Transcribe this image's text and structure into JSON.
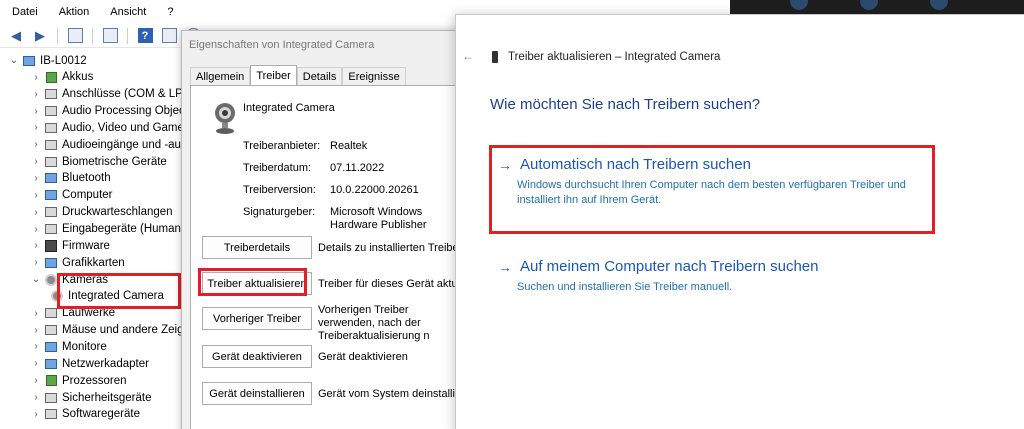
{
  "menu": [
    "Datei",
    "Aktion",
    "Ansicht",
    "?"
  ],
  "tree": {
    "root": "IB-L0012",
    "items": [
      {
        "label": "Akkus",
        "icon": "battery-icon"
      },
      {
        "label": "Anschlüsse (COM & LPT)",
        "icon": "port-icon"
      },
      {
        "label": "Audio Processing Object",
        "icon": "audio-icon"
      },
      {
        "label": "Audio, Video und Gamec",
        "icon": "audio-icon"
      },
      {
        "label": "Audioeingänge und -au",
        "icon": "audio-icon"
      },
      {
        "label": "Biometrische Geräte",
        "icon": "fingerprint-icon"
      },
      {
        "label": "Bluetooth",
        "icon": "bluetooth-icon"
      },
      {
        "label": "Computer",
        "icon": "monitor-icon"
      },
      {
        "label": "Druckwarteschlangen",
        "icon": "printer-icon"
      },
      {
        "label": "Eingabegeräte (Human I",
        "icon": "keyboard-icon"
      },
      {
        "label": "Firmware",
        "icon": "chip-icon"
      },
      {
        "label": "Grafikkarten",
        "icon": "monitor-icon"
      },
      {
        "label": "Kameras",
        "icon": "camera-icon",
        "expanded": true
      },
      {
        "label": "Integrated Camera",
        "icon": "camera-icon",
        "child": true
      },
      {
        "label": "Laufwerke",
        "icon": "drive-icon"
      },
      {
        "label": "Mäuse und andere Zeige",
        "icon": "mouse-icon"
      },
      {
        "label": "Monitore",
        "icon": "monitor-icon"
      },
      {
        "label": "Netzwerkadapter",
        "icon": "network-icon"
      },
      {
        "label": "Prozessoren",
        "icon": "cpu-icon"
      },
      {
        "label": "Sicherheitsgeräte",
        "icon": "lock-icon"
      },
      {
        "label": "Softwaregeräte",
        "icon": "software-icon"
      }
    ]
  },
  "props": {
    "title": "Eigenschaften von Integrated Camera",
    "tabs": [
      "Allgemein",
      "Treiber",
      "Details",
      "Ereignisse"
    ],
    "active_tab": "Treiber",
    "device_name": "Integrated Camera",
    "fields": [
      {
        "label": "Treiberanbieter:",
        "value": "Realtek"
      },
      {
        "label": "Treiberdatum:",
        "value": "07.11.2022"
      },
      {
        "label": "Treiberversion:",
        "value": "10.0.22000.20261"
      },
      {
        "label": "Signaturgeber:",
        "value": "Microsoft Windows Hardware Publisher"
      }
    ],
    "buttons": [
      {
        "label": "Treiberdetails",
        "desc": "Details zu installierten Treiberda"
      },
      {
        "label": "Treiber aktualisieren",
        "desc": "Treiber für dieses Gerät aktualis"
      },
      {
        "label": "Vorheriger Treiber",
        "desc": "Vorherigen Treiber verwenden, nach der Treiberaktualisierung n ordnungsgemäß funktioniert."
      },
      {
        "label": "Gerät deaktivieren",
        "desc": "Gerät deaktivieren"
      },
      {
        "label": "Gerät deinstallieren",
        "desc": "Gerät vom System deinstallier"
      }
    ]
  },
  "wizard": {
    "title": "Treiber aktualisieren – Integrated Camera",
    "heading": "Wie möchten Sie nach Treibern suchen?",
    "options": [
      {
        "title": "Automatisch nach Treibern suchen",
        "desc": "Windows durchsucht Ihren Computer nach dem besten verfügbaren Treiber und installiert ihn auf Ihrem Gerät."
      },
      {
        "title": "Auf meinem Computer nach Treibern suchen",
        "desc": "Suchen und installieren Sie Treiber manuell."
      }
    ]
  },
  "colors": {
    "highlight": "#e01f26",
    "link": "#1b56b5",
    "heading": "#1b3f8f"
  }
}
